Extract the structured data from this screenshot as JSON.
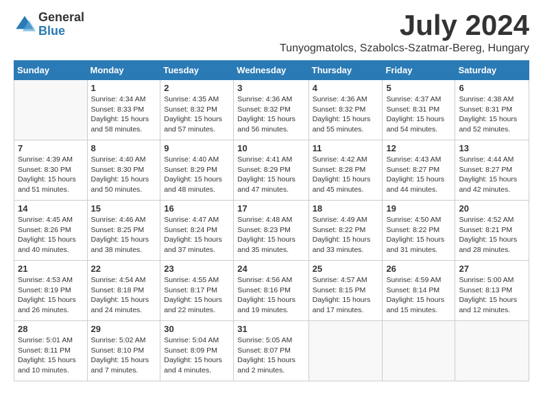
{
  "logo": {
    "general": "General",
    "blue": "Blue"
  },
  "title": "July 2024",
  "location": "Tunyogmatolcs, Szabolcs-Szatmar-Bereg, Hungary",
  "days_of_week": [
    "Sunday",
    "Monday",
    "Tuesday",
    "Wednesday",
    "Thursday",
    "Friday",
    "Saturday"
  ],
  "weeks": [
    [
      {
        "day": "",
        "info": ""
      },
      {
        "day": "1",
        "info": "Sunrise: 4:34 AM\nSunset: 8:33 PM\nDaylight: 15 hours\nand 58 minutes."
      },
      {
        "day": "2",
        "info": "Sunrise: 4:35 AM\nSunset: 8:32 PM\nDaylight: 15 hours\nand 57 minutes."
      },
      {
        "day": "3",
        "info": "Sunrise: 4:36 AM\nSunset: 8:32 PM\nDaylight: 15 hours\nand 56 minutes."
      },
      {
        "day": "4",
        "info": "Sunrise: 4:36 AM\nSunset: 8:32 PM\nDaylight: 15 hours\nand 55 minutes."
      },
      {
        "day": "5",
        "info": "Sunrise: 4:37 AM\nSunset: 8:31 PM\nDaylight: 15 hours\nand 54 minutes."
      },
      {
        "day": "6",
        "info": "Sunrise: 4:38 AM\nSunset: 8:31 PM\nDaylight: 15 hours\nand 52 minutes."
      }
    ],
    [
      {
        "day": "7",
        "info": "Sunrise: 4:39 AM\nSunset: 8:30 PM\nDaylight: 15 hours\nand 51 minutes."
      },
      {
        "day": "8",
        "info": "Sunrise: 4:40 AM\nSunset: 8:30 PM\nDaylight: 15 hours\nand 50 minutes."
      },
      {
        "day": "9",
        "info": "Sunrise: 4:40 AM\nSunset: 8:29 PM\nDaylight: 15 hours\nand 48 minutes."
      },
      {
        "day": "10",
        "info": "Sunrise: 4:41 AM\nSunset: 8:29 PM\nDaylight: 15 hours\nand 47 minutes."
      },
      {
        "day": "11",
        "info": "Sunrise: 4:42 AM\nSunset: 8:28 PM\nDaylight: 15 hours\nand 45 minutes."
      },
      {
        "day": "12",
        "info": "Sunrise: 4:43 AM\nSunset: 8:27 PM\nDaylight: 15 hours\nand 44 minutes."
      },
      {
        "day": "13",
        "info": "Sunrise: 4:44 AM\nSunset: 8:27 PM\nDaylight: 15 hours\nand 42 minutes."
      }
    ],
    [
      {
        "day": "14",
        "info": "Sunrise: 4:45 AM\nSunset: 8:26 PM\nDaylight: 15 hours\nand 40 minutes."
      },
      {
        "day": "15",
        "info": "Sunrise: 4:46 AM\nSunset: 8:25 PM\nDaylight: 15 hours\nand 38 minutes."
      },
      {
        "day": "16",
        "info": "Sunrise: 4:47 AM\nSunset: 8:24 PM\nDaylight: 15 hours\nand 37 minutes."
      },
      {
        "day": "17",
        "info": "Sunrise: 4:48 AM\nSunset: 8:23 PM\nDaylight: 15 hours\nand 35 minutes."
      },
      {
        "day": "18",
        "info": "Sunrise: 4:49 AM\nSunset: 8:22 PM\nDaylight: 15 hours\nand 33 minutes."
      },
      {
        "day": "19",
        "info": "Sunrise: 4:50 AM\nSunset: 8:22 PM\nDaylight: 15 hours\nand 31 minutes."
      },
      {
        "day": "20",
        "info": "Sunrise: 4:52 AM\nSunset: 8:21 PM\nDaylight: 15 hours\nand 28 minutes."
      }
    ],
    [
      {
        "day": "21",
        "info": "Sunrise: 4:53 AM\nSunset: 8:19 PM\nDaylight: 15 hours\nand 26 minutes."
      },
      {
        "day": "22",
        "info": "Sunrise: 4:54 AM\nSunset: 8:18 PM\nDaylight: 15 hours\nand 24 minutes."
      },
      {
        "day": "23",
        "info": "Sunrise: 4:55 AM\nSunset: 8:17 PM\nDaylight: 15 hours\nand 22 minutes."
      },
      {
        "day": "24",
        "info": "Sunrise: 4:56 AM\nSunset: 8:16 PM\nDaylight: 15 hours\nand 19 minutes."
      },
      {
        "day": "25",
        "info": "Sunrise: 4:57 AM\nSunset: 8:15 PM\nDaylight: 15 hours\nand 17 minutes."
      },
      {
        "day": "26",
        "info": "Sunrise: 4:59 AM\nSunset: 8:14 PM\nDaylight: 15 hours\nand 15 minutes."
      },
      {
        "day": "27",
        "info": "Sunrise: 5:00 AM\nSunset: 8:13 PM\nDaylight: 15 hours\nand 12 minutes."
      }
    ],
    [
      {
        "day": "28",
        "info": "Sunrise: 5:01 AM\nSunset: 8:11 PM\nDaylight: 15 hours\nand 10 minutes."
      },
      {
        "day": "29",
        "info": "Sunrise: 5:02 AM\nSunset: 8:10 PM\nDaylight: 15 hours\nand 7 minutes."
      },
      {
        "day": "30",
        "info": "Sunrise: 5:04 AM\nSunset: 8:09 PM\nDaylight: 15 hours\nand 4 minutes."
      },
      {
        "day": "31",
        "info": "Sunrise: 5:05 AM\nSunset: 8:07 PM\nDaylight: 15 hours\nand 2 minutes."
      },
      {
        "day": "",
        "info": ""
      },
      {
        "day": "",
        "info": ""
      },
      {
        "day": "",
        "info": ""
      }
    ]
  ]
}
